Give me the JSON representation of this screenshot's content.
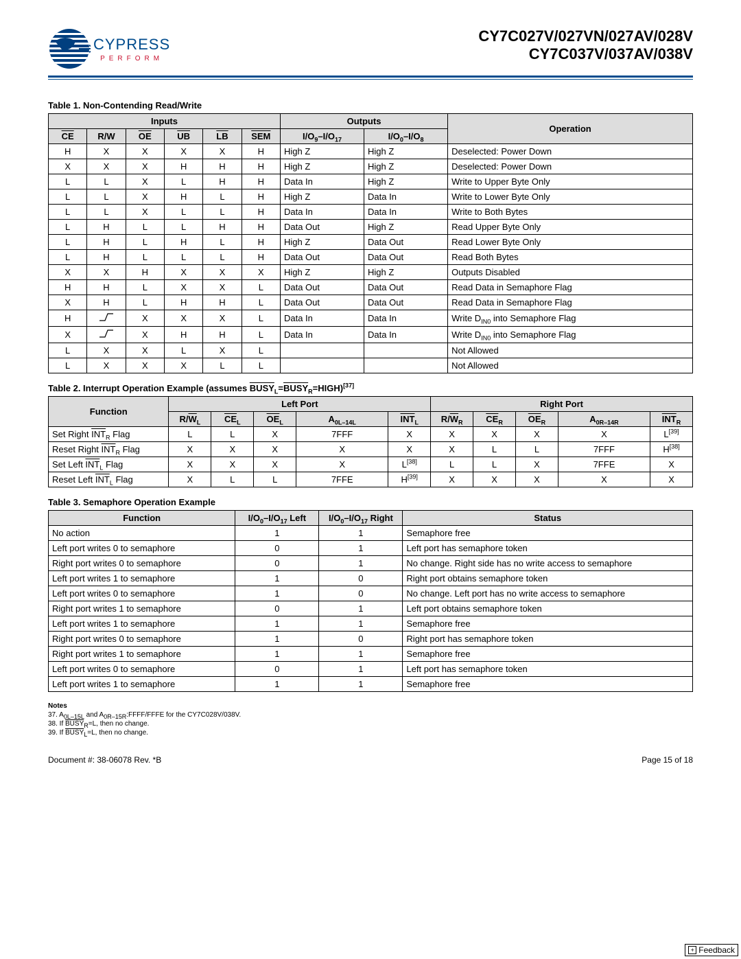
{
  "header": {
    "logo_main": "CYPRESS",
    "logo_sub": "PERFORM",
    "parts_line1": "CY7C027V/027VN/027AV/028V",
    "parts_line2": "CY7C037V/037AV/038V"
  },
  "table1": {
    "title": "Table 1.  Non-Contending Read/Write",
    "head_inputs": "Inputs",
    "head_outputs": "Outputs",
    "cols": [
      "CE",
      "R/W",
      "OE",
      "UB",
      "LB",
      "SEM",
      "I/O9–I/O17",
      "I/O0–I/O8",
      "Operation"
    ],
    "rows": [
      [
        "H",
        "X",
        "X",
        "X",
        "X",
        "H",
        "High Z",
        "High Z",
        "Deselected: Power Down"
      ],
      [
        "X",
        "X",
        "X",
        "H",
        "H",
        "H",
        "High Z",
        "High Z",
        "Deselected: Power Down"
      ],
      [
        "L",
        "L",
        "X",
        "L",
        "H",
        "H",
        "Data In",
        "High Z",
        "Write to Upper Byte Only"
      ],
      [
        "L",
        "L",
        "X",
        "H",
        "L",
        "H",
        "High Z",
        "Data In",
        "Write to Lower Byte Only"
      ],
      [
        "L",
        "L",
        "X",
        "L",
        "L",
        "H",
        "Data In",
        "Data In",
        "Write to Both Bytes"
      ],
      [
        "L",
        "H",
        "L",
        "L",
        "H",
        "H",
        "Data Out",
        "High Z",
        "Read Upper Byte Only"
      ],
      [
        "L",
        "H",
        "L",
        "H",
        "L",
        "H",
        "High Z",
        "Data Out",
        "Read Lower Byte Only"
      ],
      [
        "L",
        "H",
        "L",
        "L",
        "L",
        "H",
        "Data Out",
        "Data Out",
        "Read Both Bytes"
      ],
      [
        "X",
        "X",
        "H",
        "X",
        "X",
        "X",
        "High Z",
        "High Z",
        "Outputs Disabled"
      ],
      [
        "H",
        "H",
        "L",
        "X",
        "X",
        "L",
        "Data Out",
        "Data Out",
        "Read Data in Semaphore Flag"
      ],
      [
        "X",
        "H",
        "L",
        "H",
        "H",
        "L",
        "Data Out",
        "Data Out",
        "Read Data in Semaphore Flag"
      ],
      [
        "H",
        "__RISE__",
        "X",
        "X",
        "X",
        "L",
        "Data In",
        "Data In",
        "Write DIN0 into Semaphore Flag"
      ],
      [
        "X",
        "__RISE__",
        "X",
        "H",
        "H",
        "L",
        "Data In",
        "Data In",
        "Write DIN0 into Semaphore Flag"
      ],
      [
        "L",
        "X",
        "X",
        "L",
        "X",
        "L",
        "",
        "",
        "Not Allowed"
      ],
      [
        "L",
        "X",
        "X",
        "X",
        "L",
        "L",
        "",
        "",
        "Not Allowed"
      ]
    ]
  },
  "table2": {
    "title_pre": "Table 2.  Interrupt Operation Example (assumes ",
    "title_busy_l": "BUSY",
    "title_busy_l_sub": "L",
    "title_eq": "=",
    "title_busy_r": "BUSY",
    "title_busy_r_sub": "R",
    "title_post": "=HIGH)",
    "title_fn": "[37]",
    "left_port": "Left Port",
    "right_port": "Right Port",
    "cols": [
      "Function",
      "R/WL",
      "CEL",
      "OEL",
      "A0L–14L",
      "INTL",
      "R/WR",
      "CER",
      "OER",
      "A0R–14R",
      "INTR"
    ],
    "rows": [
      [
        "Set Right INTR Flag",
        "L",
        "L",
        "X",
        "7FFF",
        "X",
        "X",
        "X",
        "X",
        "X",
        "L[39]"
      ],
      [
        "Reset Right INTR Flag",
        "X",
        "X",
        "X",
        "X",
        "X",
        "X",
        "L",
        "L",
        "7FFF",
        "H[38]"
      ],
      [
        "Set Left INTL Flag",
        "X",
        "X",
        "X",
        "X",
        "L[38]",
        "L",
        "L",
        "X",
        "7FFE",
        "X"
      ],
      [
        "Reset Left INTL Flag",
        "X",
        "L",
        "L",
        "7FFE",
        "H[39]",
        "X",
        "X",
        "X",
        "X",
        "X"
      ]
    ]
  },
  "table3": {
    "title": "Table 3.  Semaphore Operation Example",
    "cols": [
      "Function",
      "I/O0–I/O17 Left",
      "I/O0–I/O17 Right",
      "Status"
    ],
    "rows": [
      [
        "No action",
        "1",
        "1",
        "Semaphore free"
      ],
      [
        "Left port writes 0 to semaphore",
        "0",
        "1",
        "Left port has semaphore token"
      ],
      [
        "Right port writes 0 to semaphore",
        "0",
        "1",
        "No change. Right side has no write access to semaphore"
      ],
      [
        "Left port writes 1 to semaphore",
        "1",
        "0",
        "Right port obtains semaphore token"
      ],
      [
        "Left port writes 0 to semaphore",
        "1",
        "0",
        "No change. Left port has no write access to semaphore"
      ],
      [
        "Right port writes 1 to semaphore",
        "0",
        "1",
        "Left port obtains semaphore token"
      ],
      [
        "Left port writes 1 to semaphore",
        "1",
        "1",
        "Semaphore free"
      ],
      [
        "Right port writes 0 to semaphore",
        "1",
        "0",
        "Right port has semaphore token"
      ],
      [
        "Right port writes 1 to semaphore",
        "1",
        "1",
        "Semaphore free"
      ],
      [
        "Left port writes 0 to semaphore",
        "0",
        "1",
        "Left port has semaphore token"
      ],
      [
        "Left port writes 1 to semaphore",
        "1",
        "1",
        "Semaphore free"
      ]
    ]
  },
  "notes": {
    "header": "Notes",
    "n37_pre": "37. A",
    "n37_sub1": "0L–15L",
    "n37_mid1": " and A",
    "n37_sub2": "0R–15R",
    "n37_post": ":FFFF/FFFE for the CY7C028V/038V.",
    "n38_pre": "38. If ",
    "n38_busy": "BUSY",
    "n38_sub": "R",
    "n38_post": "=L, then no change.",
    "n39_pre": "39. If ",
    "n39_busy": "BUSY",
    "n39_sub": "L",
    "n39_post": "=L, then no change."
  },
  "footer": {
    "doc": "Document #: 38-06078 Rev. *B",
    "page": "Page 15 of 18"
  },
  "feedback": {
    "label": "Feedback"
  }
}
